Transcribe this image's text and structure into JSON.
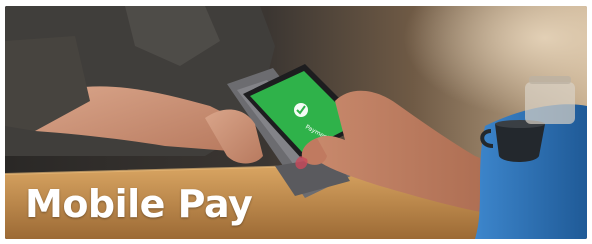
{
  "banner": {
    "title": "Mobile Pay",
    "phone_screen_text": "Payment Sent",
    "colors": {
      "title": "#ffffff",
      "phone_screen": "#2fb24a",
      "card_terminal": "#6f6f72",
      "counter": "#c8904e",
      "shirt": "#4a4845",
      "cup": "#23282d",
      "jacket_sleeve": "#2d72b8"
    },
    "icons": [
      "checkmark-icon"
    ]
  }
}
